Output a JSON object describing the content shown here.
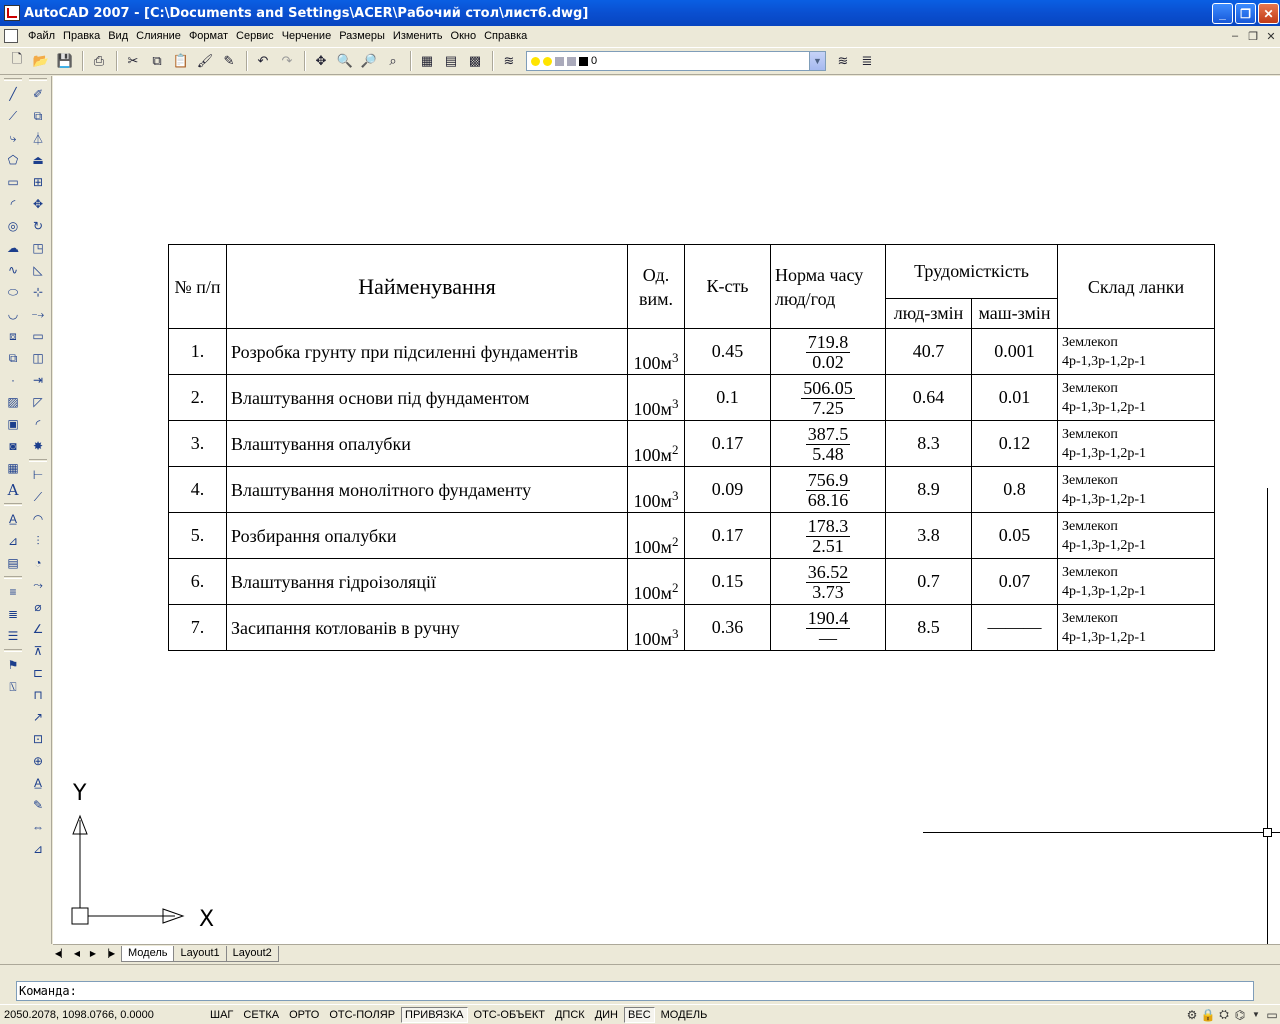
{
  "window": {
    "title": "AutoCAD 2007 - [C:\\Documents and Settings\\ACER\\Рабочий стол\\лист6.dwg]",
    "controls": {
      "minimize": "_",
      "maximize": "❐",
      "close": "✕"
    }
  },
  "menu": {
    "items": [
      "Файл",
      "Правка",
      "Вид",
      "Слияние",
      "Формат",
      "Сервис",
      "Черчение",
      "Размеры",
      "Изменить",
      "Окно",
      "Справка"
    ],
    "mdi_controls": {
      "minimize": "–",
      "restore": "❐",
      "close": "✕"
    }
  },
  "toolbar": {
    "layer_name": "0",
    "layer_swatch_color": "#000000"
  },
  "table": {
    "headers": {
      "no": "№ п/п",
      "name": "Найменування",
      "unit": "Од. вим.",
      "qty": "К-сть",
      "norm": "Норма часу люд/год",
      "labor": "Трудомісткість",
      "labor_people": "люд-змін",
      "labor_machine": "маш-змін",
      "crew": "Склад ланки"
    },
    "rows": [
      {
        "no": "1.",
        "name": "Розробка грунту при підсиленні фундаментів",
        "unit": "100м",
        "unit_power": "3",
        "qty": "0.45",
        "norm_num": "719.8",
        "norm_den": "0.02",
        "people": "40.7",
        "machine": "0.001",
        "crew_title": "Землекоп",
        "crew_detail": "4р-1,3р-1,2р-1"
      },
      {
        "no": "2.",
        "name": "Влаштування основи під фундаментом",
        "unit": "100м",
        "unit_power": "3",
        "qty": "0.1",
        "norm_num": "506.05",
        "norm_den": "7.25",
        "people": "0.64",
        "machine": "0.01",
        "crew_title": "Землекоп",
        "crew_detail": "4р-1,3р-1,2р-1"
      },
      {
        "no": "3.",
        "name": "Влаштування опалубки",
        "unit": "100м",
        "unit_power": "2",
        "qty": "0.17",
        "norm_num": "387.5",
        "norm_den": "5.48",
        "people": "8.3",
        "machine": "0.12",
        "crew_title": "Землекоп",
        "crew_detail": "4р-1,3р-1,2р-1"
      },
      {
        "no": "4.",
        "name": "Влаштування монолітного фундаменту",
        "unit": "100м",
        "unit_power": "3",
        "qty": "0.09",
        "norm_num": "756.9",
        "norm_den": "68.16",
        "people": "8.9",
        "machine": "0.8",
        "crew_title": "Землекоп",
        "crew_detail": "4р-1,3р-1,2р-1"
      },
      {
        "no": "5.",
        "name": "Розбирання опалубки",
        "unit": "100м",
        "unit_power": "2",
        "qty": "0.17",
        "norm_num": "178.3",
        "norm_den": "2.51",
        "people": "3.8",
        "machine": "0.05",
        "crew_title": "Землекоп",
        "crew_detail": "4р-1,3р-1,2р-1"
      },
      {
        "no": "6.",
        "name": "Влаштування гідроізоляції",
        "unit": "100м",
        "unit_power": "2",
        "qty": "0.15",
        "norm_num": "36.52",
        "norm_den": "3.73",
        "people": "0.7",
        "machine": "0.07",
        "crew_title": "Землекоп",
        "crew_detail": "4р-1,3р-1,2р-1"
      },
      {
        "no": "7.",
        "name": "Засипання котлованів в ручну",
        "unit": "100м",
        "unit_power": "3",
        "qty": "0.36",
        "norm_num": "190.4",
        "norm_den": "—",
        "people": "8.5",
        "machine": "———",
        "crew_title": "Землекоп",
        "crew_detail": "4р-1,3р-1,2р-1"
      }
    ]
  },
  "ucs": {
    "x_label": "X",
    "y_label": "Y"
  },
  "tabs": {
    "items": [
      "Модель",
      "Layout1",
      "Layout2"
    ],
    "active": "Модель"
  },
  "command": {
    "prompt": "Команда:"
  },
  "status": {
    "coords": "2050.2078, 1098.0766, 0.0000",
    "buttons": [
      {
        "label": "ШАГ",
        "on": false
      },
      {
        "label": "СЕТКА",
        "on": false
      },
      {
        "label": "ОРТО",
        "on": false
      },
      {
        "label": "ОТС-ПОЛЯР",
        "on": false
      },
      {
        "label": "ПРИВЯЗКА",
        "on": true
      },
      {
        "label": "ОТС-ОБЪЕКТ",
        "on": false
      },
      {
        "label": "ДПСК",
        "on": false
      },
      {
        "label": "ДИН",
        "on": false
      },
      {
        "label": "ВЕС",
        "on": true
      },
      {
        "label": "МОДЕЛЬ",
        "on": false
      }
    ]
  }
}
